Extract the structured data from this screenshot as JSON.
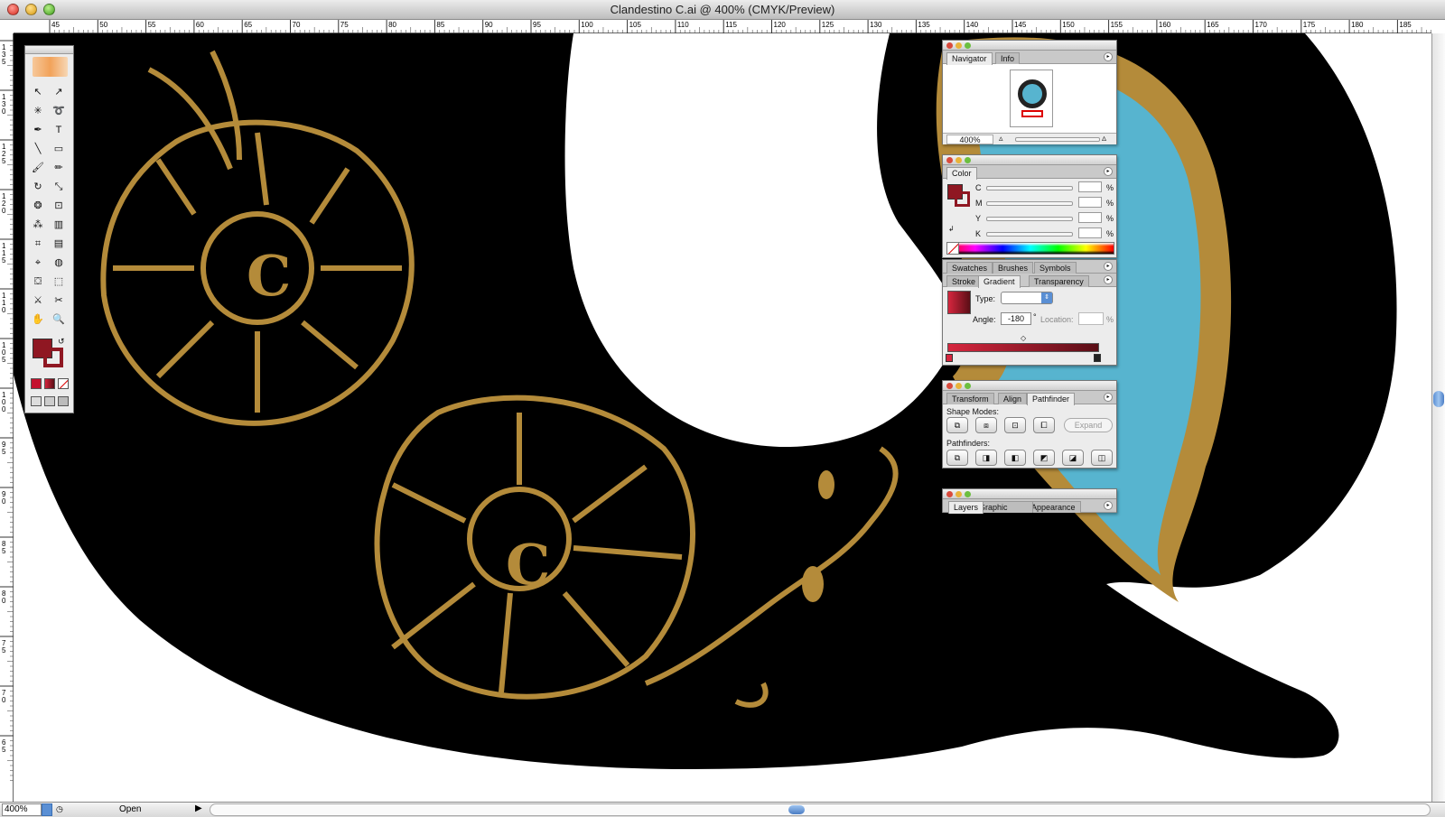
{
  "window": {
    "title": "Clandestino C.ai @ 400% (CMYK/Preview)"
  },
  "rulers": {
    "horizontal_ticks": [
      "45",
      "50",
      "55",
      "60",
      "65",
      "70",
      "75",
      "80",
      "85",
      "90",
      "95",
      "100",
      "105",
      "110",
      "115",
      "120",
      "125",
      "130",
      "135",
      "140",
      "145",
      "150",
      "155",
      "160",
      "165",
      "170",
      "175",
      "180",
      "185"
    ],
    "vertical_ticks": [
      "135",
      "130",
      "125",
      "120",
      "115",
      "110",
      "105",
      "100",
      "95",
      "90",
      "85",
      "80",
      "75",
      "70",
      "65"
    ]
  },
  "artwork": {
    "letters": [
      "C",
      "C"
    ]
  },
  "toolbox": {
    "tools": [
      {
        "name": "selection-tool-icon",
        "glyph": "↖"
      },
      {
        "name": "direct-selection-tool-icon",
        "glyph": "↗"
      },
      {
        "name": "magic-wand-tool-icon",
        "glyph": "✳"
      },
      {
        "name": "lasso-tool-icon",
        "glyph": "➰"
      },
      {
        "name": "pen-tool-icon",
        "glyph": "✒"
      },
      {
        "name": "type-tool-icon",
        "glyph": "T"
      },
      {
        "name": "line-tool-icon",
        "glyph": "╲"
      },
      {
        "name": "rectangle-tool-icon",
        "glyph": "▭"
      },
      {
        "name": "paintbrush-tool-icon",
        "glyph": "🖌"
      },
      {
        "name": "pencil-tool-icon",
        "glyph": "✏"
      },
      {
        "name": "rotate-tool-icon",
        "glyph": "↻"
      },
      {
        "name": "scale-tool-icon",
        "glyph": "⤡"
      },
      {
        "name": "warp-tool-icon",
        "glyph": "❂"
      },
      {
        "name": "free-transform-tool-icon",
        "glyph": "⊡"
      },
      {
        "name": "symbol-sprayer-tool-icon",
        "glyph": "⁂"
      },
      {
        "name": "graph-tool-icon",
        "glyph": "▥"
      },
      {
        "name": "mesh-tool-icon",
        "glyph": "⌗"
      },
      {
        "name": "gradient-tool-icon",
        "glyph": "▤"
      },
      {
        "name": "eyedropper-tool-icon",
        "glyph": "⌖"
      },
      {
        "name": "blend-tool-icon",
        "glyph": "◍"
      },
      {
        "name": "live-paint-bucket-tool-icon",
        "glyph": "⛋"
      },
      {
        "name": "live-paint-selection-tool-icon",
        "glyph": "⬚"
      },
      {
        "name": "slice-tool-icon",
        "glyph": "⚔"
      },
      {
        "name": "scissors-tool-icon",
        "glyph": "✂"
      },
      {
        "name": "hand-tool-icon",
        "glyph": "✋"
      },
      {
        "name": "zoom-tool-icon",
        "glyph": "🔍"
      }
    ]
  },
  "navigator": {
    "tabs": [
      "Navigator",
      "Info"
    ],
    "zoom": "400%"
  },
  "color": {
    "tab": "Color",
    "channels": [
      "C",
      "M",
      "Y",
      "K"
    ],
    "unit": "%"
  },
  "gradient": {
    "tabs_top": [
      "Swatches",
      "Brushes",
      "Symbols"
    ],
    "tabs": [
      "Stroke",
      "Gradient",
      "Transparency"
    ],
    "type_label": "Type:",
    "angle_label": "Angle:",
    "angle_value": "-180",
    "degree": "°",
    "location_label": "Location:",
    "unit": "%"
  },
  "pathfinder": {
    "tabs": [
      "Transform",
      "Align",
      "Pathfinder"
    ],
    "shape_modes_label": "Shape Modes:",
    "expand_label": "Expand",
    "pathfinders_label": "Pathfinders:"
  },
  "layers": {
    "tabs": [
      "Layers",
      "Graphic Styles",
      "Appearance"
    ]
  },
  "statusbar": {
    "zoom": "400%",
    "status": "Open"
  },
  "colors": {
    "gold": "#b48b3a",
    "black": "#000000",
    "blue": "#57b4cf",
    "fill": "#8f1722"
  }
}
